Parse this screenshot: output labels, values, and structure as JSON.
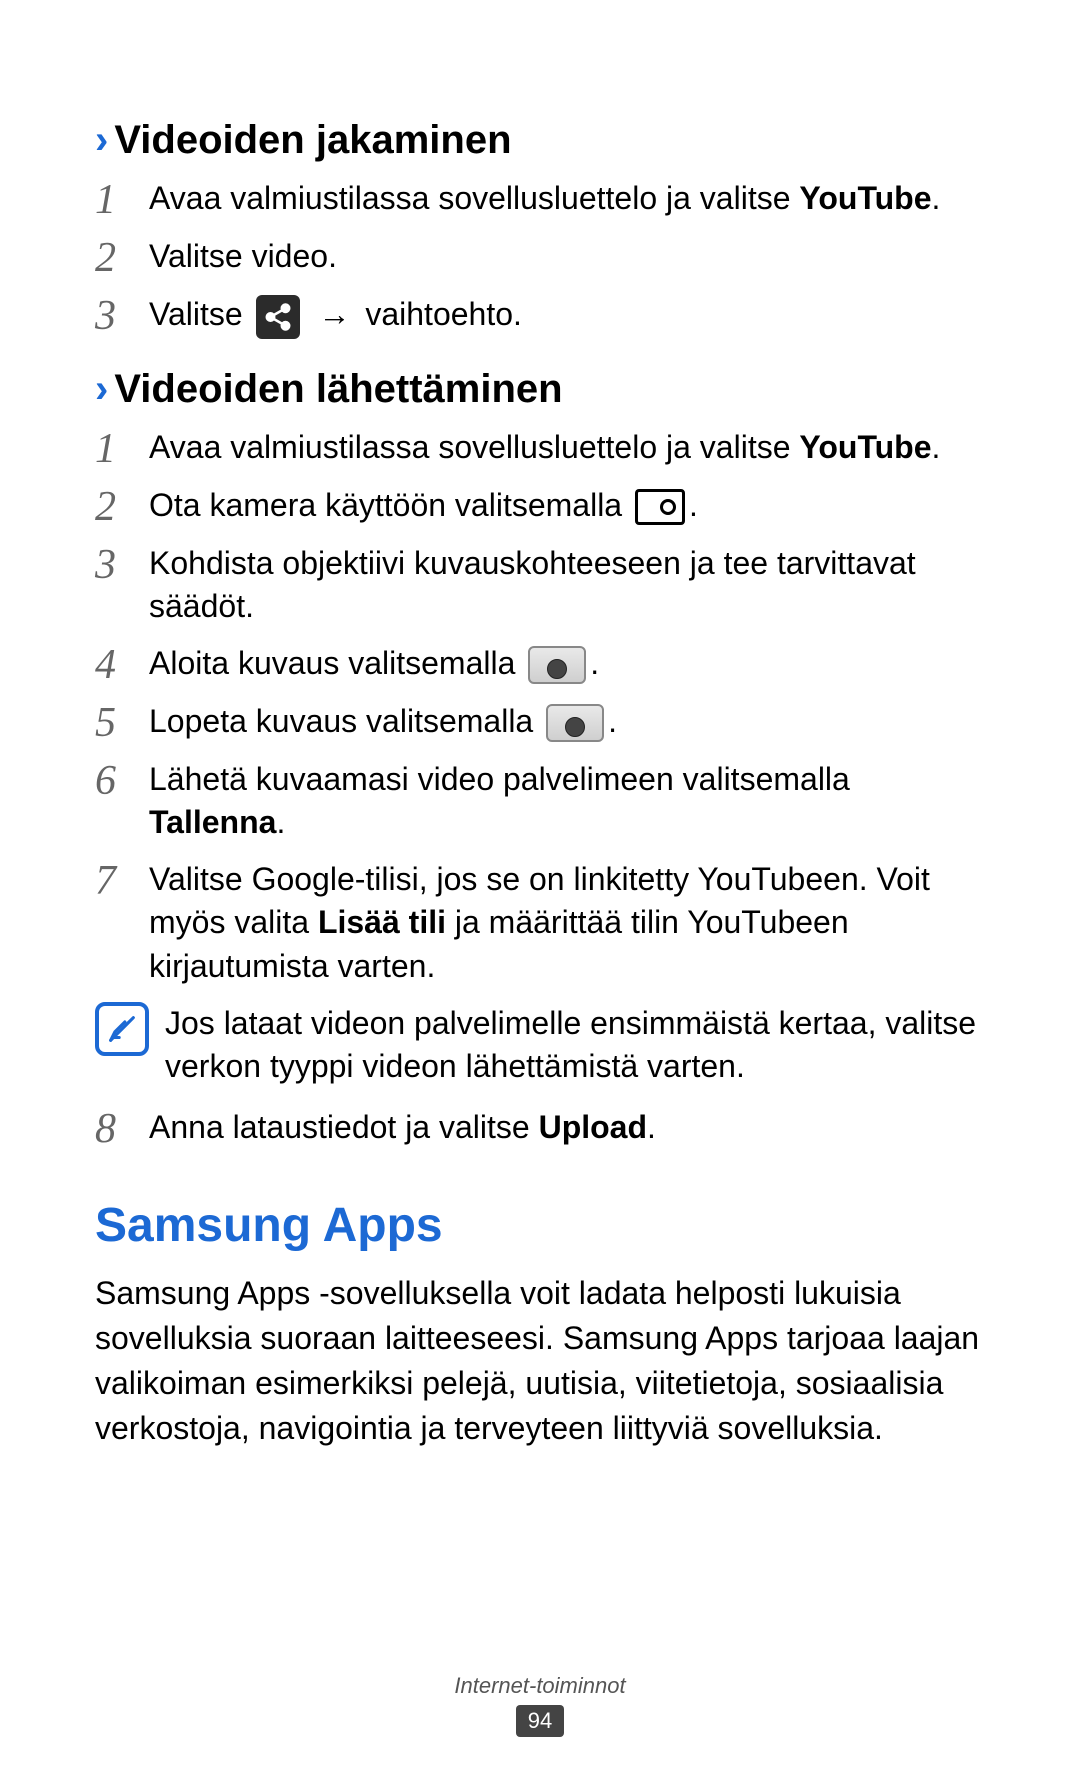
{
  "sections": {
    "share": {
      "title": "Videoiden jakaminen",
      "steps": {
        "s1": {
          "num": "1",
          "pre": "Avaa valmiustilassa sovellusluettelo ja valitse ",
          "bold": "YouTube",
          "post": "."
        },
        "s2": {
          "num": "2",
          "text": "Valitse video."
        },
        "s3": {
          "num": "3",
          "pre": "Valitse ",
          "post": " vaihtoehto.",
          "arrow": "→"
        }
      }
    },
    "upload": {
      "title": "Videoiden lähettäminen",
      "steps": {
        "s1": {
          "num": "1",
          "pre": "Avaa valmiustilassa sovellusluettelo ja valitse ",
          "bold": "YouTube",
          "post": "."
        },
        "s2": {
          "num": "2",
          "pre": "Ota kamera käyttöön valitsemalla ",
          "post": "."
        },
        "s3": {
          "num": "3",
          "text": "Kohdista objektiivi kuvauskohteeseen ja tee tarvittavat säädöt."
        },
        "s4": {
          "num": "4",
          "pre": "Aloita kuvaus valitsemalla ",
          "post": "."
        },
        "s5": {
          "num": "5",
          "pre": "Lopeta kuvaus valitsemalla ",
          "post": "."
        },
        "s6": {
          "num": "6",
          "pre": "Lähetä kuvaamasi video palvelimeen valitsemalla ",
          "bold": "Tallenna",
          "post": "."
        },
        "s7": {
          "num": "7",
          "pre": "Valitse Google-tilisi, jos se on linkitetty YouTubeen. Voit myös valita ",
          "bold": "Lisää tili",
          "post": " ja määrittää tilin YouTubeen kirjautumista varten."
        },
        "note": "Jos lataat videon palvelimelle ensimmäistä kertaa, valitse verkon tyyppi videon lähettämistä varten.",
        "s8": {
          "num": "8",
          "pre": "Anna lataustiedot ja valitse ",
          "bold": "Upload",
          "post": "."
        }
      }
    }
  },
  "samsung": {
    "title": "Samsung Apps",
    "body": "Samsung Apps -sovelluksella voit ladata helposti lukuisia sovelluksia suoraan laitteeseesi. Samsung Apps tarjoaa laajan valikoiman esimerkiksi pelejä, uutisia, viitetietoja, sosiaalisia verkostoja, navigointia ja terveyteen liittyviä sovelluksia."
  },
  "footer": {
    "section": "Internet-toiminnot",
    "page": "94"
  },
  "chevron": "›"
}
